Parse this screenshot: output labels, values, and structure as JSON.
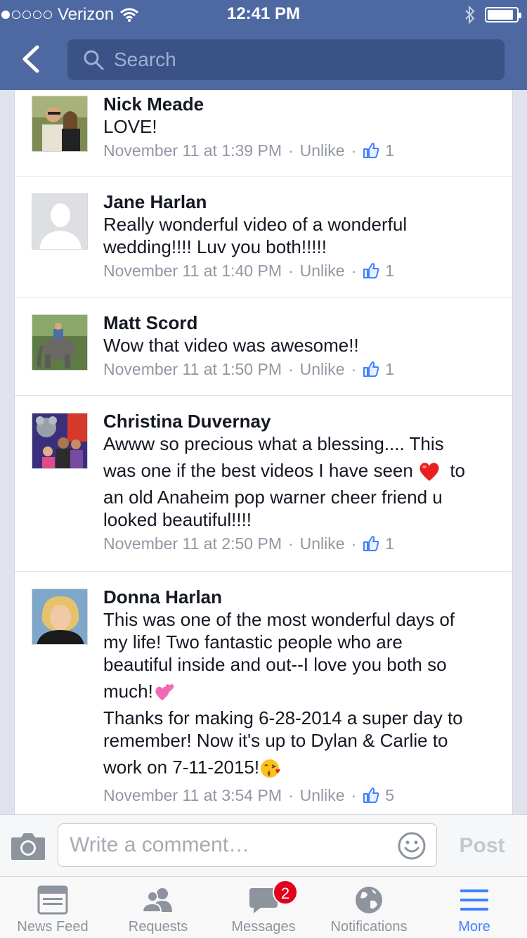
{
  "status_bar": {
    "carrier": "Verizon",
    "time": "12:41 PM",
    "signal_bars": 1,
    "signal_max": 5,
    "battery_level": 0.9
  },
  "nav": {
    "back_icon": "chevron-left-icon",
    "search_placeholder": "Search"
  },
  "comments": [
    {
      "name": "Nick Meade",
      "lines": [
        "LOVE!"
      ],
      "time": "November 11 at 1:39 PM",
      "action": "Unlike",
      "likes": "1",
      "avatar": "couple-photo"
    },
    {
      "name": "Jane Harlan",
      "lines": [
        "Really wonderful video of a wonderful",
        "wedding!!!! Luv you both!!!!!"
      ],
      "time": "November 11 at 1:40 PM",
      "action": "Unlike",
      "likes": "1",
      "avatar": "default-silhouette"
    },
    {
      "name": "Matt Scord",
      "lines": [
        "Wow that video was awesome!!"
      ],
      "time": "November 11 at 1:50 PM",
      "action": "Unlike",
      "likes": "1",
      "avatar": "elephant-photo"
    },
    {
      "name": "Christina Duvernay",
      "lines": [
        "Awww so precious what a blessing.... This",
        "was one if the best videos I have seen",
        "to",
        "an old Anaheim pop warner cheer friend u",
        "looked beautiful!!!!"
      ],
      "time": "November 11 at 2:50 PM",
      "action": "Unlike",
      "likes": "1",
      "avatar": "group-photo",
      "emoji": "red-heart-emoji"
    },
    {
      "name": "Donna Harlan",
      "lines": [
        "This was one of the most wonderful days of",
        "my life! Two fantastic people who are",
        "beautiful inside and out--I love you both so",
        "much!",
        "Thanks for making 6-28-2014 a super day to",
        "remember! Now it's up to Dylan & Carlie to",
        "work on 7-11-2015!"
      ],
      "time": "November 11 at 3:54 PM",
      "action": "Unlike",
      "likes": "5",
      "avatar": "portrait-photo",
      "emojis": [
        "two-hearts-emoji",
        "kissing-face-emoji"
      ]
    }
  ],
  "composer": {
    "camera_icon": "camera-icon",
    "placeholder": "Write a comment…",
    "emoji_icon": "smiley-icon",
    "post_label": "Post"
  },
  "tabbar": {
    "tabs": [
      {
        "label": "News Feed",
        "icon": "news-feed-icon"
      },
      {
        "label": "Requests",
        "icon": "friend-requests-icon"
      },
      {
        "label": "Messages",
        "icon": "messages-icon",
        "badge": "2"
      },
      {
        "label": "Notifications",
        "icon": "globe-icon"
      },
      {
        "label": "More",
        "icon": "hamburger-icon",
        "active": true
      }
    ]
  },
  "colors": {
    "header": "#4e69a2",
    "search_bg": "#3b5286",
    "meta_text": "#9197a3",
    "like_blue": "#4080ff",
    "badge_red": "#e3001b"
  }
}
